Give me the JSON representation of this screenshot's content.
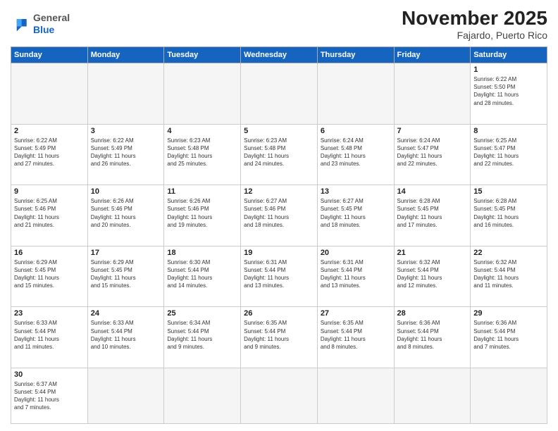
{
  "header": {
    "logo_general": "General",
    "logo_blue": "Blue",
    "month_year": "November 2025",
    "location": "Fajardo, Puerto Rico"
  },
  "weekdays": [
    "Sunday",
    "Monday",
    "Tuesday",
    "Wednesday",
    "Thursday",
    "Friday",
    "Saturday"
  ],
  "days": [
    {
      "num": "",
      "info": ""
    },
    {
      "num": "",
      "info": ""
    },
    {
      "num": "",
      "info": ""
    },
    {
      "num": "",
      "info": ""
    },
    {
      "num": "",
      "info": ""
    },
    {
      "num": "",
      "info": ""
    },
    {
      "num": "1",
      "info": "Sunrise: 6:22 AM\nSunset: 5:50 PM\nDaylight: 11 hours\nand 28 minutes."
    },
    {
      "num": "2",
      "info": "Sunrise: 6:22 AM\nSunset: 5:49 PM\nDaylight: 11 hours\nand 27 minutes."
    },
    {
      "num": "3",
      "info": "Sunrise: 6:22 AM\nSunset: 5:49 PM\nDaylight: 11 hours\nand 26 minutes."
    },
    {
      "num": "4",
      "info": "Sunrise: 6:23 AM\nSunset: 5:48 PM\nDaylight: 11 hours\nand 25 minutes."
    },
    {
      "num": "5",
      "info": "Sunrise: 6:23 AM\nSunset: 5:48 PM\nDaylight: 11 hours\nand 24 minutes."
    },
    {
      "num": "6",
      "info": "Sunrise: 6:24 AM\nSunset: 5:48 PM\nDaylight: 11 hours\nand 23 minutes."
    },
    {
      "num": "7",
      "info": "Sunrise: 6:24 AM\nSunset: 5:47 PM\nDaylight: 11 hours\nand 22 minutes."
    },
    {
      "num": "8",
      "info": "Sunrise: 6:25 AM\nSunset: 5:47 PM\nDaylight: 11 hours\nand 22 minutes."
    },
    {
      "num": "9",
      "info": "Sunrise: 6:25 AM\nSunset: 5:46 PM\nDaylight: 11 hours\nand 21 minutes."
    },
    {
      "num": "10",
      "info": "Sunrise: 6:26 AM\nSunset: 5:46 PM\nDaylight: 11 hours\nand 20 minutes."
    },
    {
      "num": "11",
      "info": "Sunrise: 6:26 AM\nSunset: 5:46 PM\nDaylight: 11 hours\nand 19 minutes."
    },
    {
      "num": "12",
      "info": "Sunrise: 6:27 AM\nSunset: 5:46 PM\nDaylight: 11 hours\nand 18 minutes."
    },
    {
      "num": "13",
      "info": "Sunrise: 6:27 AM\nSunset: 5:45 PM\nDaylight: 11 hours\nand 18 minutes."
    },
    {
      "num": "14",
      "info": "Sunrise: 6:28 AM\nSunset: 5:45 PM\nDaylight: 11 hours\nand 17 minutes."
    },
    {
      "num": "15",
      "info": "Sunrise: 6:28 AM\nSunset: 5:45 PM\nDaylight: 11 hours\nand 16 minutes."
    },
    {
      "num": "16",
      "info": "Sunrise: 6:29 AM\nSunset: 5:45 PM\nDaylight: 11 hours\nand 15 minutes."
    },
    {
      "num": "17",
      "info": "Sunrise: 6:29 AM\nSunset: 5:45 PM\nDaylight: 11 hours\nand 15 minutes."
    },
    {
      "num": "18",
      "info": "Sunrise: 6:30 AM\nSunset: 5:44 PM\nDaylight: 11 hours\nand 14 minutes."
    },
    {
      "num": "19",
      "info": "Sunrise: 6:31 AM\nSunset: 5:44 PM\nDaylight: 11 hours\nand 13 minutes."
    },
    {
      "num": "20",
      "info": "Sunrise: 6:31 AM\nSunset: 5:44 PM\nDaylight: 11 hours\nand 13 minutes."
    },
    {
      "num": "21",
      "info": "Sunrise: 6:32 AM\nSunset: 5:44 PM\nDaylight: 11 hours\nand 12 minutes."
    },
    {
      "num": "22",
      "info": "Sunrise: 6:32 AM\nSunset: 5:44 PM\nDaylight: 11 hours\nand 11 minutes."
    },
    {
      "num": "23",
      "info": "Sunrise: 6:33 AM\nSunset: 5:44 PM\nDaylight: 11 hours\nand 11 minutes."
    },
    {
      "num": "24",
      "info": "Sunrise: 6:33 AM\nSunset: 5:44 PM\nDaylight: 11 hours\nand 10 minutes."
    },
    {
      "num": "25",
      "info": "Sunrise: 6:34 AM\nSunset: 5:44 PM\nDaylight: 11 hours\nand 9 minutes."
    },
    {
      "num": "26",
      "info": "Sunrise: 6:35 AM\nSunset: 5:44 PM\nDaylight: 11 hours\nand 9 minutes."
    },
    {
      "num": "27",
      "info": "Sunrise: 6:35 AM\nSunset: 5:44 PM\nDaylight: 11 hours\nand 8 minutes."
    },
    {
      "num": "28",
      "info": "Sunrise: 6:36 AM\nSunset: 5:44 PM\nDaylight: 11 hours\nand 8 minutes."
    },
    {
      "num": "29",
      "info": "Sunrise: 6:36 AM\nSunset: 5:44 PM\nDaylight: 11 hours\nand 7 minutes."
    },
    {
      "num": "30",
      "info": "Sunrise: 6:37 AM\nSunset: 5:44 PM\nDaylight: 11 hours\nand 7 minutes."
    }
  ]
}
